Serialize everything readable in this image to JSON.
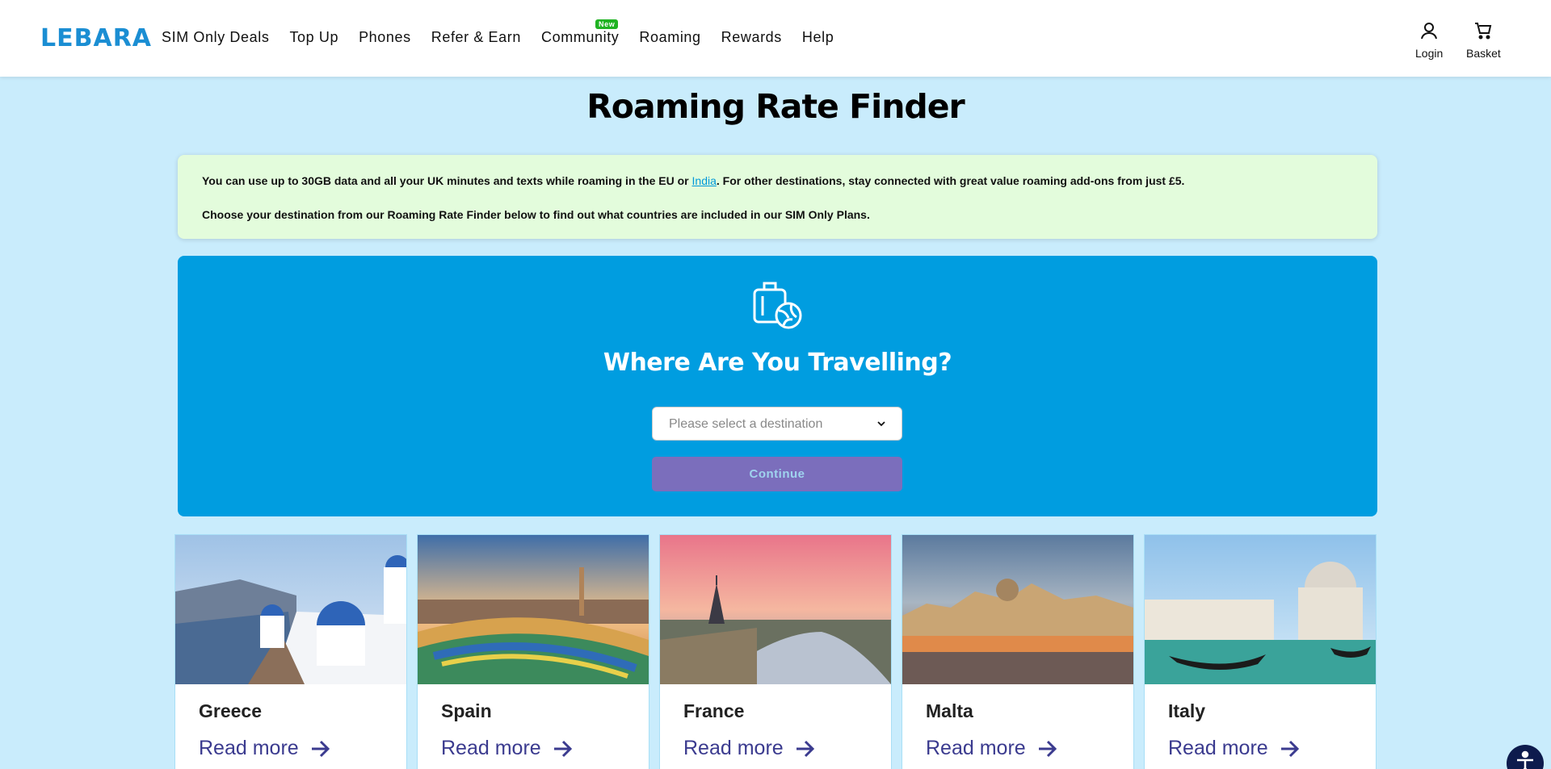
{
  "brand": {
    "logo_text": "LEBARA",
    "color": "#1b8ed3"
  },
  "nav": {
    "items": [
      {
        "label": "SIM Only Deals"
      },
      {
        "label": "Top Up"
      },
      {
        "label": "Phones"
      },
      {
        "label": "Refer & Earn"
      },
      {
        "label": "Community",
        "badge": "New"
      },
      {
        "label": "Roaming"
      },
      {
        "label": "Rewards"
      },
      {
        "label": "Help"
      }
    ]
  },
  "header_actions": {
    "login_label": "Login",
    "basket_label": "Basket"
  },
  "page": {
    "title": "Roaming Rate Finder"
  },
  "info": {
    "line1_before": "You can use up to 30GB data and all your UK minutes and texts while roaming in the EU or ",
    "line1_link": "India",
    "line1_after": ". For other destinations, stay connected with great value roaming add-ons from just £5.",
    "line2": "Choose your destination from our Roaming Rate Finder below to find out what countries are included in our SIM Only Plans."
  },
  "finder": {
    "icon": "luggage-globe-icon",
    "heading": "Where Are You Travelling?",
    "select_placeholder": "Please select a destination",
    "continue_label": "Continue"
  },
  "destinations": [
    {
      "name": "Greece",
      "link": "Read more"
    },
    {
      "name": "Spain",
      "link": "Read more"
    },
    {
      "name": "France",
      "link": "Read more"
    },
    {
      "name": "Malta",
      "link": "Read more"
    },
    {
      "name": "Italy",
      "link": "Read more"
    }
  ],
  "colors": {
    "background": "#c9ecfc",
    "info_box": "#e3fcdc",
    "finder_panel": "#009de0",
    "continue_button": "#7b6ebc",
    "link": "#3b3b8f",
    "badge": "#1fb322"
  }
}
